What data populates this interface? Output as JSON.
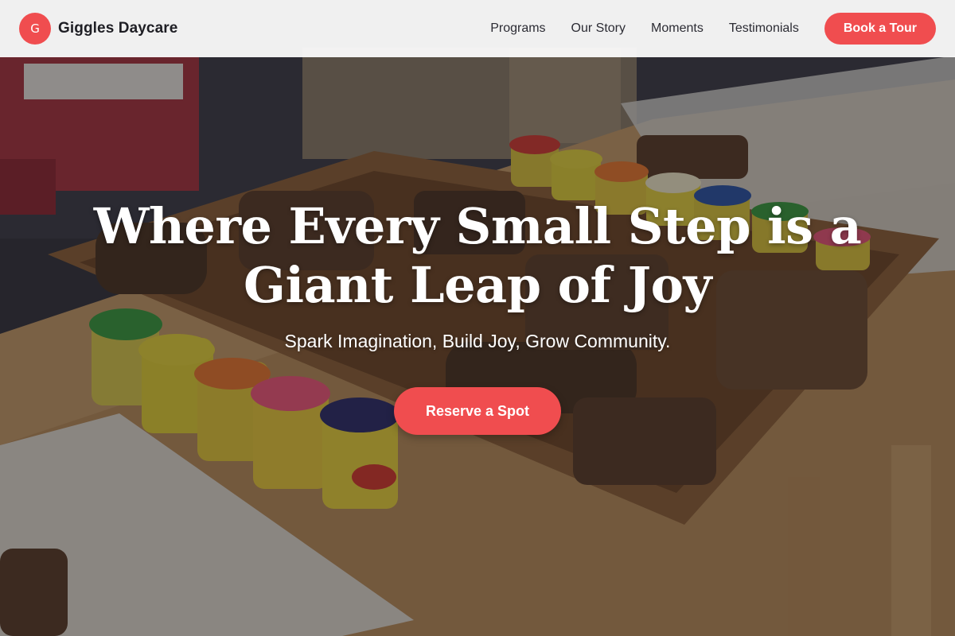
{
  "brand": {
    "logo_letter": "G",
    "name": "Giggles Daycare",
    "color": "#f04d4f"
  },
  "nav": {
    "links": [
      "Programs",
      "Our Story",
      "Moments",
      "Testimonials"
    ],
    "cta_label": "Book a Tour"
  },
  "hero": {
    "title": "Where Every Small Step is a Giant Leap of Joy",
    "subtitle": "Spark Imagination, Build Joy, Grow Community.",
    "cta_label": "Reserve a Spot",
    "background_image": "classroom table with wooden alphabet letters and play-dough tubs"
  },
  "colors": {
    "accent": "#f04d4f",
    "nav_text": "#2c2c34",
    "hero_text": "#ffffff"
  }
}
